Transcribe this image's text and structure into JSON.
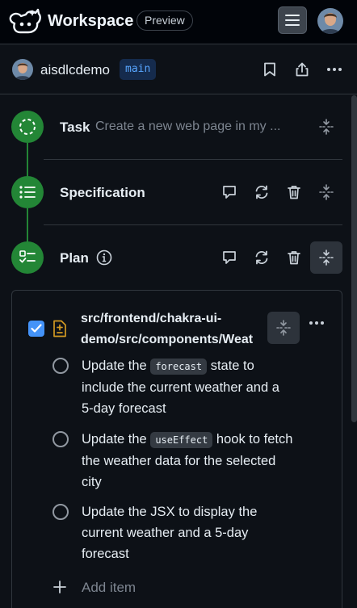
{
  "header": {
    "app_title": "Workspace",
    "badge": "Preview",
    "logo_icon": "copilot-logo-icon",
    "menu_icon": "hamburger-menu-icon"
  },
  "repo": {
    "name": "aisdlcdemo",
    "branch": "main",
    "actions": [
      "bookmark-icon",
      "share-icon",
      "kebab-horizontal-icon"
    ]
  },
  "steps": [
    {
      "title": "Task",
      "description": "Create a new web page in my ...",
      "icon": "dashed-circle-icon"
    },
    {
      "title": "Specification",
      "icon": "list-icon",
      "actions": [
        "comment-icon",
        "sync-icon",
        "trash-icon",
        "fold-icon"
      ]
    },
    {
      "title": "Plan",
      "icon": "checklist-icon",
      "info_icon": "info-icon",
      "actions": [
        "comment-icon",
        "sync-icon",
        "trash-icon",
        "fold-icon"
      ]
    }
  ],
  "plan": {
    "file_path_line1": "src/frontend/chakra-ui-",
    "file_path_line2": "demo/src/components/Weat",
    "file_icon": "file-diff-icon",
    "checked": true,
    "tasks": [
      {
        "pre": "Update the ",
        "code": "forecast",
        "post": " state to include the current weather and a 5-day forecast"
      },
      {
        "pre": "Update the ",
        "code": "useEffect",
        "post": " hook to fetch the weather data for the selected city"
      },
      {
        "pre": "Update the JSX to display the current weather and a 5-day forecast",
        "code": "",
        "post": ""
      }
    ],
    "add_item_label": "Add item"
  },
  "colors": {
    "background": "#0d1117",
    "step_green": "#238636",
    "accent_blue": "#4493f8",
    "file_icon_yellow": "#d29922"
  }
}
